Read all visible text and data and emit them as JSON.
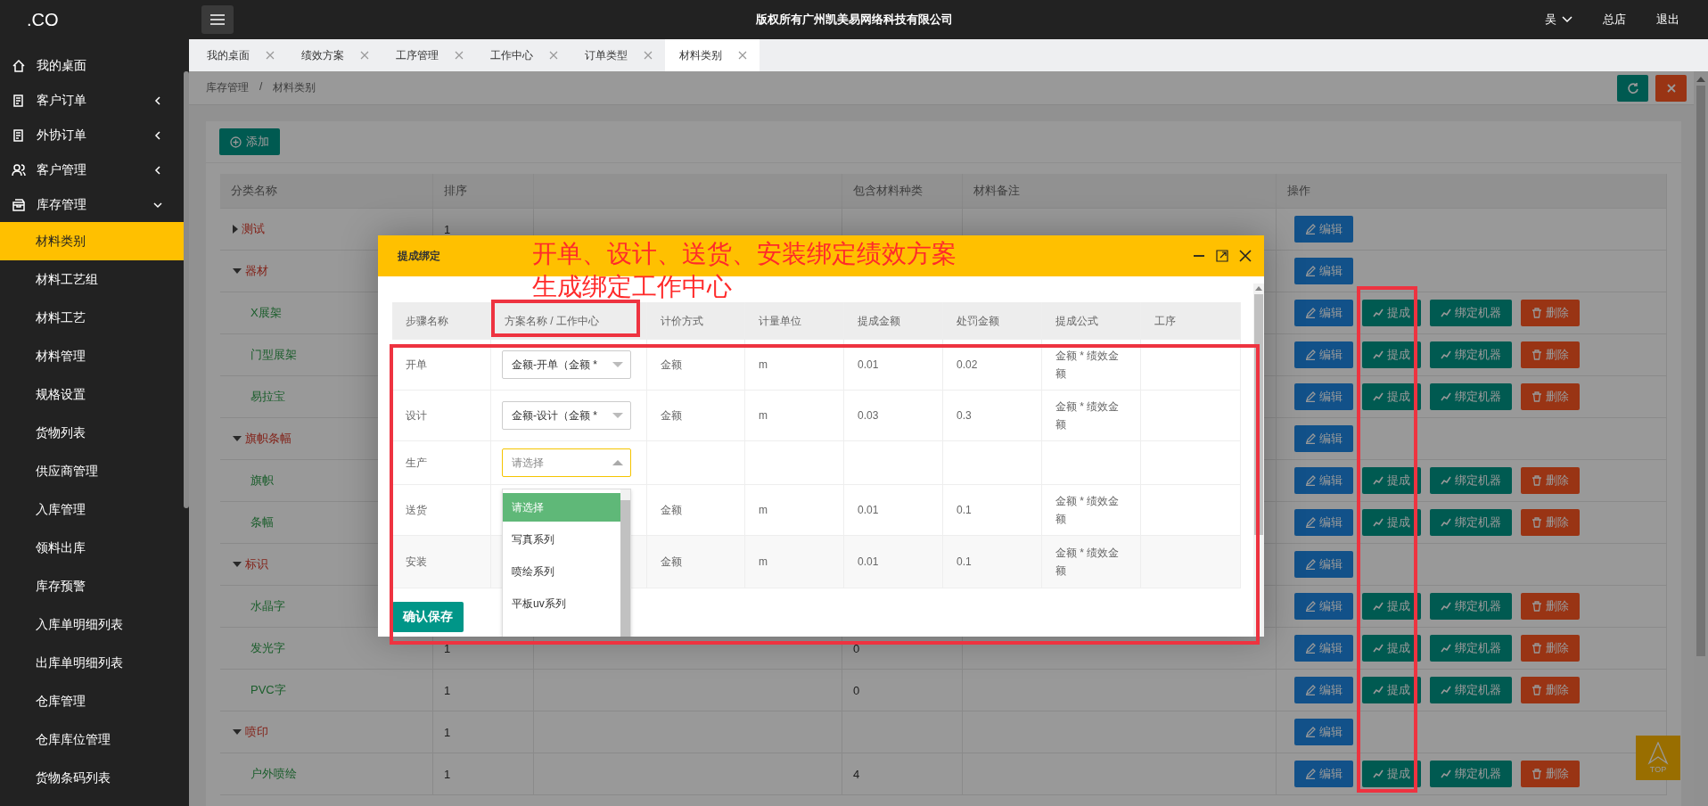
{
  "header": {
    "logo": ".CO",
    "title": "版权所有广州凯美易网络科技有限公司",
    "user": "吴",
    "store": "总店",
    "logout": "退出"
  },
  "sidebar": {
    "items": [
      {
        "label": "我的桌面"
      },
      {
        "label": "客户订单",
        "expanded": false
      },
      {
        "label": "外协订单",
        "expanded": false
      },
      {
        "label": "客户管理",
        "expanded": false
      },
      {
        "label": "库存管理",
        "expanded": true,
        "children": [
          {
            "label": "材料类别",
            "selected": true
          },
          {
            "label": "材料工艺组",
            "selected": false
          },
          {
            "label": "材料工艺",
            "selected": false
          },
          {
            "label": "材料管理",
            "selected": false
          },
          {
            "label": "规格设置",
            "selected": false
          },
          {
            "label": "货物列表",
            "selected": false
          },
          {
            "label": "供应商管理",
            "selected": false
          },
          {
            "label": "入库管理",
            "selected": false
          },
          {
            "label": "领料出库",
            "selected": false
          },
          {
            "label": "库存预警",
            "selected": false
          },
          {
            "label": "入库单明细列表",
            "selected": false
          },
          {
            "label": "出库单明细列表",
            "selected": false
          },
          {
            "label": "仓库管理",
            "selected": false
          },
          {
            "label": "仓库库位管理",
            "selected": false
          },
          {
            "label": "货物条码列表",
            "selected": false
          }
        ]
      }
    ]
  },
  "tabs": [
    {
      "label": "我的桌面",
      "selected": false
    },
    {
      "label": "绩效方案",
      "selected": false
    },
    {
      "label": "工序管理",
      "selected": false
    },
    {
      "label": "工作中心",
      "selected": false
    },
    {
      "label": "订单类型",
      "selected": false
    },
    {
      "label": "材料类别",
      "selected": true
    }
  ],
  "breadcrumb": [
    "库存管理",
    "材料类别"
  ],
  "breadcrumb_separator": "/",
  "add_button": "添加",
  "table": {
    "columns": [
      "分类名称",
      "排序",
      "包含材料种类",
      "材料备注",
      "操作"
    ],
    "rows": [
      {
        "name": "测试",
        "kind": "category",
        "expanded": false,
        "sort": "1",
        "actions": [
          {
            "kind": "edit",
            "label": "编辑"
          }
        ]
      },
      {
        "name": "器材",
        "kind": "category",
        "expanded": true,
        "actions": [
          {
            "kind": "edit",
            "label": "编辑"
          }
        ]
      },
      {
        "name": "X展架",
        "kind": "item",
        "actions": [
          {
            "kind": "edit",
            "label": "编辑"
          },
          {
            "kind": "commission",
            "label": "提成"
          },
          {
            "kind": "bind",
            "label": "绑定机器"
          },
          {
            "kind": "delete",
            "label": "删除"
          }
        ]
      },
      {
        "name": "门型展架",
        "kind": "item",
        "actions": [
          {
            "kind": "edit",
            "label": "编辑"
          },
          {
            "kind": "commission",
            "label": "提成"
          },
          {
            "kind": "bind",
            "label": "绑定机器"
          },
          {
            "kind": "delete",
            "label": "删除"
          }
        ]
      },
      {
        "name": "易拉宝",
        "kind": "item",
        "actions": [
          {
            "kind": "edit",
            "label": "编辑"
          },
          {
            "kind": "commission",
            "label": "提成"
          },
          {
            "kind": "bind",
            "label": "绑定机器"
          },
          {
            "kind": "delete",
            "label": "删除"
          }
        ]
      },
      {
        "name": "旗帜条幅",
        "kind": "category",
        "expanded": true,
        "actions": [
          {
            "kind": "edit",
            "label": "编辑"
          }
        ]
      },
      {
        "name": "旗帜",
        "kind": "item",
        "actions": [
          {
            "kind": "edit",
            "label": "编辑"
          },
          {
            "kind": "commission",
            "label": "提成"
          },
          {
            "kind": "bind",
            "label": "绑定机器"
          },
          {
            "kind": "delete",
            "label": "删除"
          }
        ]
      },
      {
        "name": "条幅",
        "kind": "item",
        "actions": [
          {
            "kind": "edit",
            "label": "编辑"
          },
          {
            "kind": "commission",
            "label": "提成"
          },
          {
            "kind": "bind",
            "label": "绑定机器"
          },
          {
            "kind": "delete",
            "label": "删除"
          }
        ]
      },
      {
        "name": "标识",
        "kind": "category",
        "expanded": true,
        "actions": [
          {
            "kind": "edit",
            "label": "编辑"
          }
        ]
      },
      {
        "name": "水晶字",
        "kind": "item",
        "actions": [
          {
            "kind": "edit",
            "label": "编辑"
          },
          {
            "kind": "commission",
            "label": "提成"
          },
          {
            "kind": "bind",
            "label": "绑定机器"
          },
          {
            "kind": "delete",
            "label": "删除"
          }
        ]
      },
      {
        "name": "发光字",
        "kind": "item",
        "sort": "1",
        "count": "0",
        "actions": [
          {
            "kind": "edit",
            "label": "编辑"
          },
          {
            "kind": "commission",
            "label": "提成"
          },
          {
            "kind": "bind",
            "label": "绑定机器"
          },
          {
            "kind": "delete",
            "label": "删除"
          }
        ]
      },
      {
        "name": "PVC字",
        "kind": "item",
        "sort": "1",
        "count": "0",
        "actions": [
          {
            "kind": "edit",
            "label": "编辑"
          },
          {
            "kind": "commission",
            "label": "提成"
          },
          {
            "kind": "bind",
            "label": "绑定机器"
          },
          {
            "kind": "delete",
            "label": "删除"
          }
        ]
      },
      {
        "name": "喷印",
        "kind": "category",
        "expanded": true,
        "sort": "1",
        "actions": [
          {
            "kind": "edit",
            "label": "编辑"
          }
        ]
      },
      {
        "name": "户外喷绘",
        "kind": "item",
        "sort": "1",
        "count": "4",
        "actions": [
          {
            "kind": "edit",
            "label": "编辑"
          },
          {
            "kind": "commission",
            "label": "提成"
          },
          {
            "kind": "bind",
            "label": "绑定机器"
          },
          {
            "kind": "delete",
            "label": "删除"
          }
        ]
      }
    ]
  },
  "top_button": "TOP",
  "modal": {
    "title": "提成绑定",
    "columns": [
      "步骤名称",
      "方案名称 / 工作中心",
      "计价方式",
      "计量单位",
      "提成金额",
      "处罚金额",
      "提成公式",
      "工序"
    ],
    "rows": [
      {
        "step": "开单",
        "plan": {
          "value": "金额-开单（金额 *",
          "open": false
        },
        "pricing": "金额",
        "unit": "m",
        "commission": "0.01",
        "penalty": "0.02",
        "formula": "金额 * 绩效金额"
      },
      {
        "step": "设计",
        "plan": {
          "value": "金额-设计（金额 *",
          "open": false
        },
        "pricing": "金额",
        "unit": "m",
        "commission": "0.03",
        "penalty": "0.3",
        "formula": "金额 * 绩效金额"
      },
      {
        "step": "生产",
        "plan": {
          "placeholder": "请选择",
          "open": true,
          "options": [
            {
              "label": "请选择",
              "selected": true
            },
            {
              "label": "写真系列",
              "selected": false
            },
            {
              "label": "喷绘系列",
              "selected": false
            },
            {
              "label": "平板uv系列",
              "selected": false
            }
          ]
        }
      },
      {
        "step": "送货",
        "pricing": "金额",
        "unit": "m",
        "commission": "0.01",
        "penalty": "0.1",
        "formula": "金额 * 绩效金额"
      },
      {
        "step": "安装",
        "pricing": "金额",
        "unit": "m",
        "commission": "0.01",
        "penalty": "0.1",
        "formula": "金额 * 绩效金额"
      }
    ],
    "save_button": "确认保存"
  },
  "annotation": {
    "lines": [
      "开单、设计、送货、安装绑定绩效方案",
      "生成绑定工作中心"
    ]
  }
}
